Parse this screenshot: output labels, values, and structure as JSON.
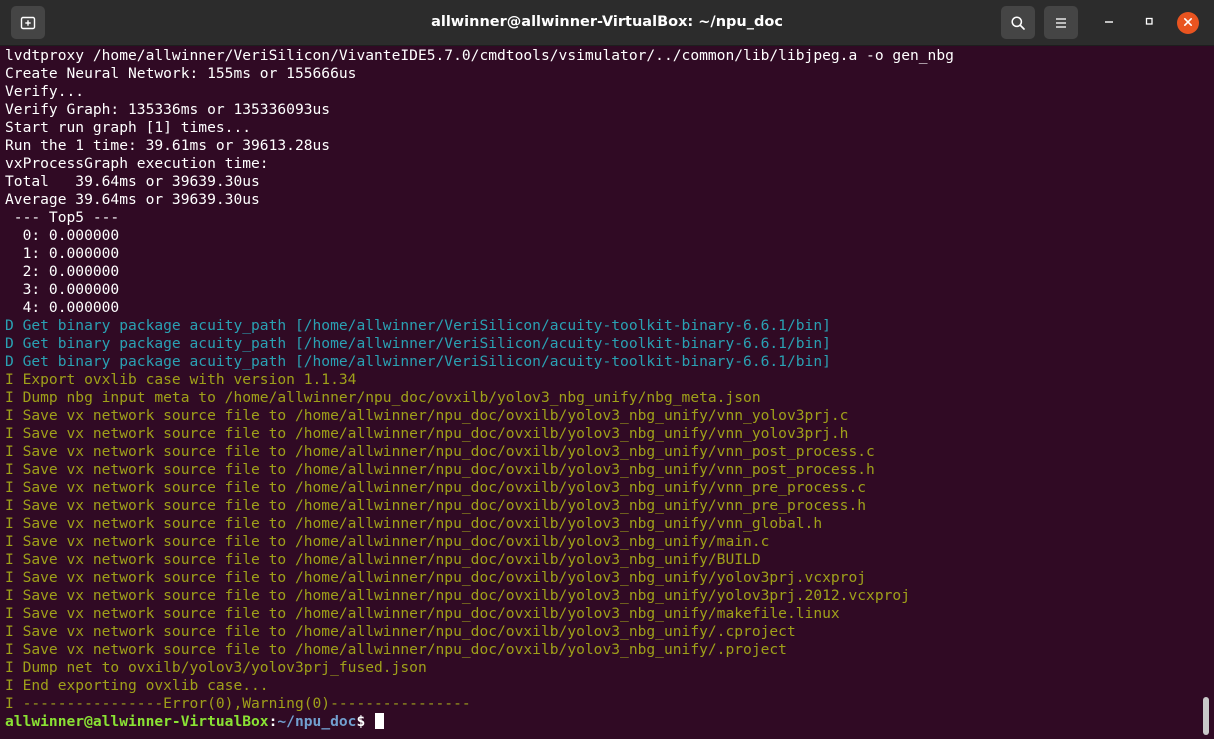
{
  "window": {
    "title": "allwinner@allwinner-VirtualBox: ~/npu_doc"
  },
  "icons": {
    "new_tab": "new-tab-icon",
    "search": "search-icon",
    "menu": "hamburger-menu-icon",
    "minimize": "minimize-icon",
    "maximize": "maximize-icon",
    "close": "close-icon"
  },
  "colors": {
    "terminal_bg": "#300a24",
    "titlebar_bg": "#2c2c2c",
    "text_white": "#ffffff",
    "text_cyan": "#2aa1b3",
    "text_green": "#9fa01a",
    "prompt_user": "#8ae234",
    "prompt_path": "#729fcf",
    "close_accent": "#e95420"
  },
  "terminal": {
    "lines": [
      {
        "text": "lvdtproxy /home/allwinner/VeriSilicon/VivanteIDE5.7.0/cmdtools/vsimulator/../common/lib/libjpeg.a -o gen_nbg",
        "color": "white"
      },
      {
        "text": "Create Neural Network: 155ms or 155666us",
        "color": "white"
      },
      {
        "text": "Verify...",
        "color": "white"
      },
      {
        "text": "Verify Graph: 135336ms or 135336093us",
        "color": "white"
      },
      {
        "text": "Start run graph [1] times...",
        "color": "white"
      },
      {
        "text": "Run the 1 time: 39.61ms or 39613.28us",
        "color": "white"
      },
      {
        "text": "vxProcessGraph execution time:",
        "color": "white"
      },
      {
        "text": "Total   39.64ms or 39639.30us",
        "color": "white"
      },
      {
        "text": "Average 39.64ms or 39639.30us",
        "color": "white"
      },
      {
        "text": " --- Top5 ---",
        "color": "white"
      },
      {
        "text": "  0: 0.000000",
        "color": "white"
      },
      {
        "text": "  1: 0.000000",
        "color": "white"
      },
      {
        "text": "  2: 0.000000",
        "color": "white"
      },
      {
        "text": "  3: 0.000000",
        "color": "white"
      },
      {
        "text": "  4: 0.000000",
        "color": "white"
      },
      {
        "text": "D Get binary package acuity_path [/home/allwinner/VeriSilicon/acuity-toolkit-binary-6.6.1/bin]",
        "color": "cyan"
      },
      {
        "text": "D Get binary package acuity_path [/home/allwinner/VeriSilicon/acuity-toolkit-binary-6.6.1/bin]",
        "color": "cyan"
      },
      {
        "text": "D Get binary package acuity_path [/home/allwinner/VeriSilicon/acuity-toolkit-binary-6.6.1/bin]",
        "color": "cyan"
      },
      {
        "text": "I Export ovxlib case with version 1.1.34",
        "color": "green"
      },
      {
        "text": "I Dump nbg input meta to /home/allwinner/npu_doc/ovxilb/yolov3_nbg_unify/nbg_meta.json",
        "color": "green"
      },
      {
        "text": "I Save vx network source file to /home/allwinner/npu_doc/ovxilb/yolov3_nbg_unify/vnn_yolov3prj.c",
        "color": "green"
      },
      {
        "text": "I Save vx network source file to /home/allwinner/npu_doc/ovxilb/yolov3_nbg_unify/vnn_yolov3prj.h",
        "color": "green"
      },
      {
        "text": "I Save vx network source file to /home/allwinner/npu_doc/ovxilb/yolov3_nbg_unify/vnn_post_process.c",
        "color": "green"
      },
      {
        "text": "I Save vx network source file to /home/allwinner/npu_doc/ovxilb/yolov3_nbg_unify/vnn_post_process.h",
        "color": "green"
      },
      {
        "text": "I Save vx network source file to /home/allwinner/npu_doc/ovxilb/yolov3_nbg_unify/vnn_pre_process.c",
        "color": "green"
      },
      {
        "text": "I Save vx network source file to /home/allwinner/npu_doc/ovxilb/yolov3_nbg_unify/vnn_pre_process.h",
        "color": "green"
      },
      {
        "text": "I Save vx network source file to /home/allwinner/npu_doc/ovxilb/yolov3_nbg_unify/vnn_global.h",
        "color": "green"
      },
      {
        "text": "I Save vx network source file to /home/allwinner/npu_doc/ovxilb/yolov3_nbg_unify/main.c",
        "color": "green"
      },
      {
        "text": "I Save vx network source file to /home/allwinner/npu_doc/ovxilb/yolov3_nbg_unify/BUILD",
        "color": "green"
      },
      {
        "text": "I Save vx network source file to /home/allwinner/npu_doc/ovxilb/yolov3_nbg_unify/yolov3prj.vcxproj",
        "color": "green"
      },
      {
        "text": "I Save vx network source file to /home/allwinner/npu_doc/ovxilb/yolov3_nbg_unify/yolov3prj.2012.vcxproj",
        "color": "green"
      },
      {
        "text": "I Save vx network source file to /home/allwinner/npu_doc/ovxilb/yolov3_nbg_unify/makefile.linux",
        "color": "green"
      },
      {
        "text": "I Save vx network source file to /home/allwinner/npu_doc/ovxilb/yolov3_nbg_unify/.cproject",
        "color": "green"
      },
      {
        "text": "I Save vx network source file to /home/allwinner/npu_doc/ovxilb/yolov3_nbg_unify/.project",
        "color": "green"
      },
      {
        "text": "I Dump net to ovxilb/yolov3/yolov3prj_fused.json",
        "color": "green"
      },
      {
        "text": "I End exporting ovxlib case...",
        "color": "green"
      },
      {
        "text": "I ----------------Error(0),Warning(0)----------------",
        "color": "green"
      }
    ],
    "prompt": {
      "user_host": "allwinner@allwinner-VirtualBox",
      "separator": ":",
      "path": "~/npu_doc",
      "symbol": "$ "
    }
  }
}
